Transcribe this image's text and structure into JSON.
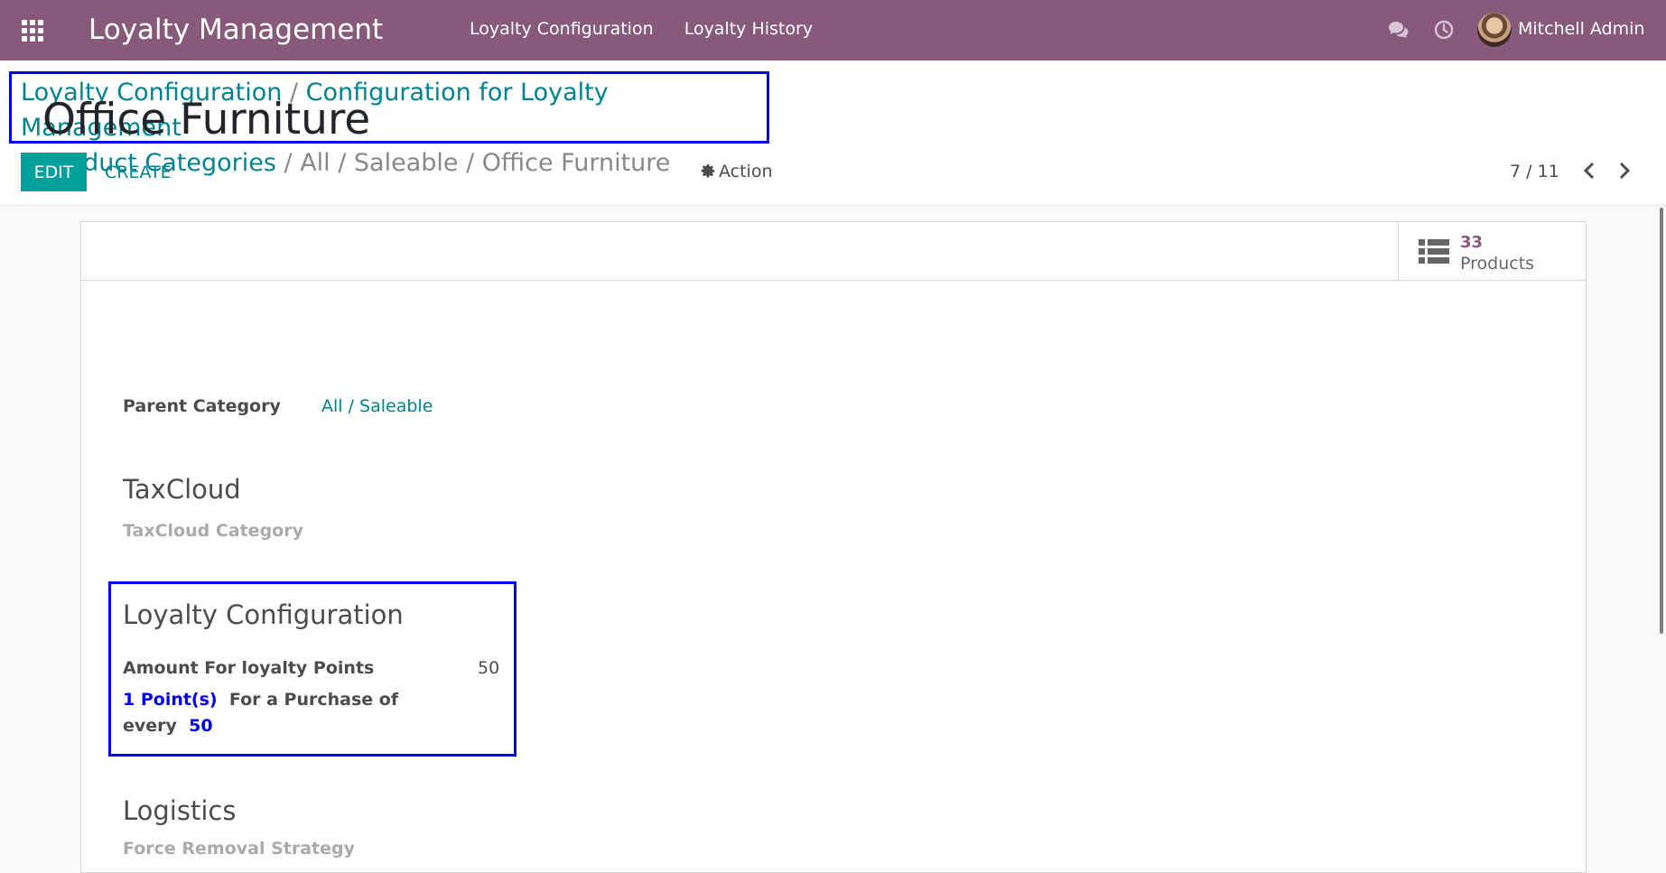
{
  "navbar": {
    "app_title": "Loyalty Management",
    "menu": [
      "Loyalty Configuration",
      "Loyalty History"
    ],
    "user_name": "Mitchell Admin",
    "brand_color": "#875a7b"
  },
  "breadcrumb": {
    "items": [
      {
        "label": "Loyalty Configuration",
        "link": true
      },
      {
        "label": "Configuration for Loyalty Management",
        "link": true
      },
      {
        "label": "Product Categories",
        "link": true
      },
      {
        "label": "All / Saleable / Office Furniture",
        "link": false
      }
    ]
  },
  "toolbar": {
    "edit_label": "EDIT",
    "create_label": "CREATE",
    "action_label": "Action",
    "pager": "7 / 11"
  },
  "stat_button": {
    "value": "33",
    "label": "Products"
  },
  "record": {
    "title": "Office Furniture",
    "parent_category_label": "Parent Category",
    "parent_category_value": "All / Saleable"
  },
  "taxcloud": {
    "title": "TaxCloud",
    "category_label": "TaxCloud Category"
  },
  "loyalty": {
    "title": "Loyalty Configuration",
    "amount_label": "Amount For loyalty Points",
    "amount_value": "50",
    "points": "1 Point(s)",
    "rule_text": "For a Purchase of every",
    "rule_amount": "50"
  },
  "logistics": {
    "title": "Logistics",
    "removal_label": "Force Removal Strategy"
  }
}
